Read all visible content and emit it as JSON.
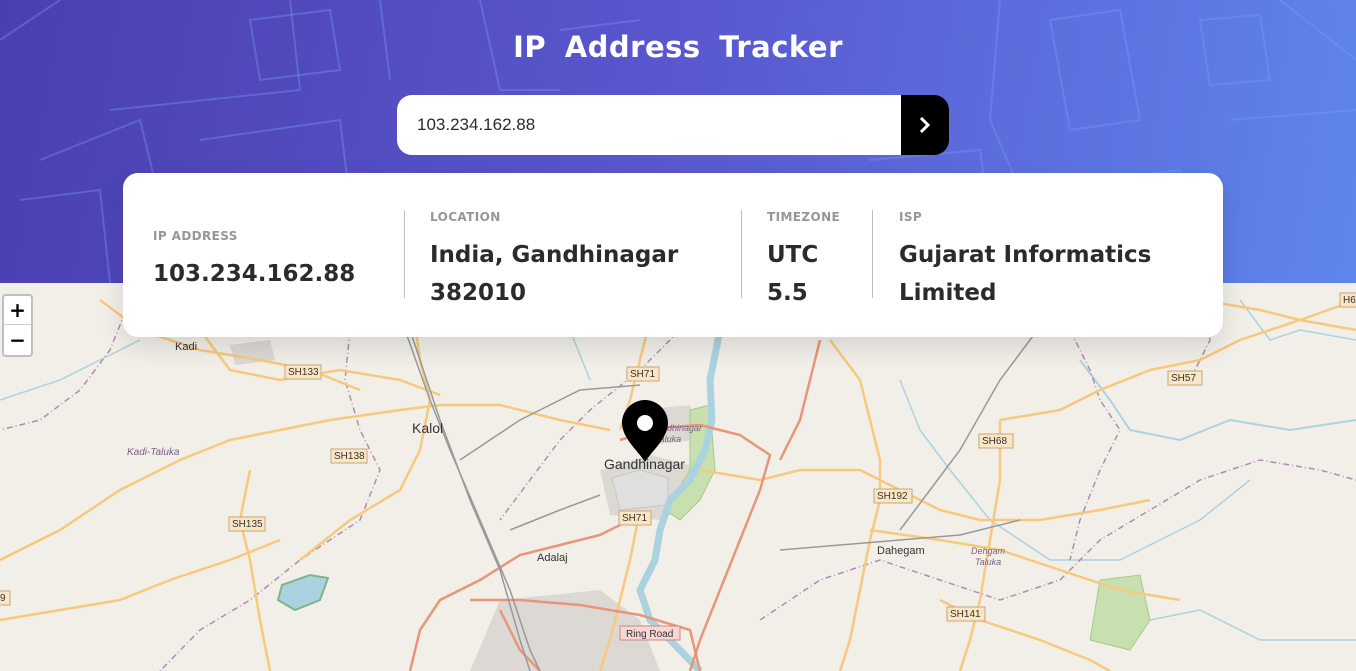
{
  "header": {
    "title": "IP Address Tracker"
  },
  "search": {
    "value": "103.234.162.88",
    "button_icon": "chevron-right-icon"
  },
  "info": {
    "ip": {
      "label": "IP ADDRESS",
      "value": "103.234.162.88"
    },
    "location": {
      "label": "LOCATION",
      "line1": "India, Gandhinagar",
      "line2": "382010"
    },
    "timezone": {
      "label": "TIMEZONE",
      "line1": "UTC",
      "line2": "5.5"
    },
    "isp": {
      "label": "ISP",
      "line1": "Gujarat Informatics",
      "line2": "Limited"
    }
  },
  "map": {
    "zoom_in": "+",
    "zoom_out": "−",
    "marker_icon": "location-pin-icon",
    "places": {
      "gandhinagar": "Gandhinagar",
      "kalol": "Kalol",
      "kadi": "Kadi",
      "kadi_taluka": "Kadi-Taluka",
      "adalaj": "Adalaj",
      "dahegam": "Dahegam",
      "dehgam_taluka_1": "Dehgam",
      "dehgam_taluka_2": "Taluka",
      "gandhinagar_taluka_1": "Gandhinagar",
      "gandhinagar_taluka_2": "Taluka"
    },
    "roads": {
      "sh133": "SH133",
      "sh71_top": "SH71",
      "sh71_bottom": "SH71",
      "sh138": "SH138",
      "sh135": "SH135",
      "sh57": "SH57",
      "sh68": "SH68",
      "sh192": "SH192",
      "sh141": "SH141",
      "ring_road": "Ring Road",
      "edge_left": "9",
      "edge_right": "H6"
    }
  },
  "colors": {
    "gradient_start": "#4a3fb0",
    "gradient_end": "#5e86ec",
    "text_dark": "#2b2b2b",
    "label_gray": "#969696"
  }
}
